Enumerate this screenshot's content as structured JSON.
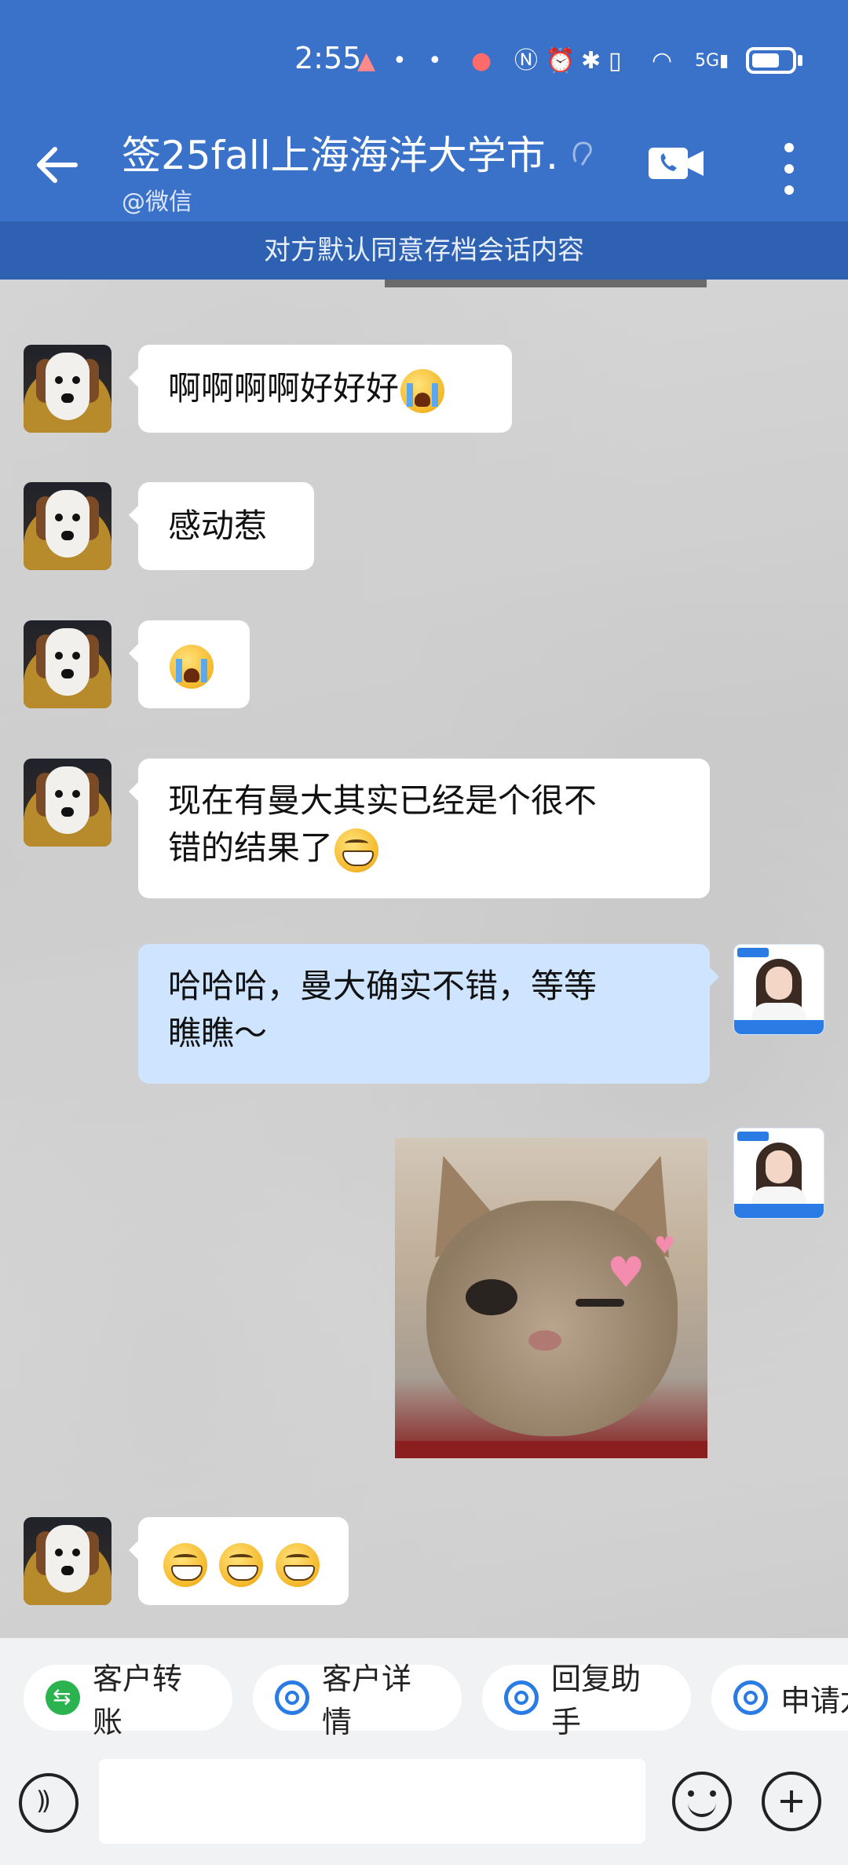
{
  "status_bar": {
    "time": "2:55",
    "icons": [
      "notification-icon",
      "app-icon",
      "app-icon",
      "app-icon",
      "nfc-icon",
      "alarm-icon",
      "bluetooth-icon",
      "vibrate-icon",
      "wifi-icon",
      "signal-5g-icon",
      "battery-icon"
    ]
  },
  "header": {
    "title": "签25fall上海海洋大学市…",
    "subtitle": "@微信",
    "notice": "对方默认同意存档会话内容"
  },
  "messages": [
    {
      "side": "in",
      "text": "啊啊啊啊好好好",
      "emoji": [
        "cry"
      ]
    },
    {
      "side": "in",
      "text": "感动惹",
      "emoji": []
    },
    {
      "side": "in",
      "text": "",
      "emoji": [
        "cry"
      ]
    },
    {
      "side": "in",
      "lines": [
        "现在有曼大其实已经是个很不",
        "错的结果了"
      ],
      "emoji": [
        "grin"
      ]
    },
    {
      "side": "out",
      "lines": [
        "哈哈哈，曼大确实不错，等等",
        "瞧瞧～"
      ]
    },
    {
      "side": "out",
      "image": "cat-wink-sticker"
    },
    {
      "side": "in",
      "text": "",
      "emoji": [
        "grin",
        "grin",
        "grin"
      ]
    }
  ],
  "quick_actions": [
    {
      "label": "客户转账",
      "icon": "transfer-icon",
      "color": "#2bb34f"
    },
    {
      "label": "客户详情",
      "icon": "detail-icon",
      "color": "#2a7be4"
    },
    {
      "label": "回复助手",
      "icon": "assistant-icon",
      "color": "#2a7be4"
    },
    {
      "label": "申请龙",
      "icon": "apply-icon",
      "color": "#2a7be4"
    }
  ],
  "input": {
    "value": "",
    "placeholder": ""
  },
  "colors": {
    "header_bg": "#3a72c9",
    "notice_bg": "#2e61b2",
    "out_bubble": "#cfe5ff",
    "in_bubble": "#ffffff"
  }
}
